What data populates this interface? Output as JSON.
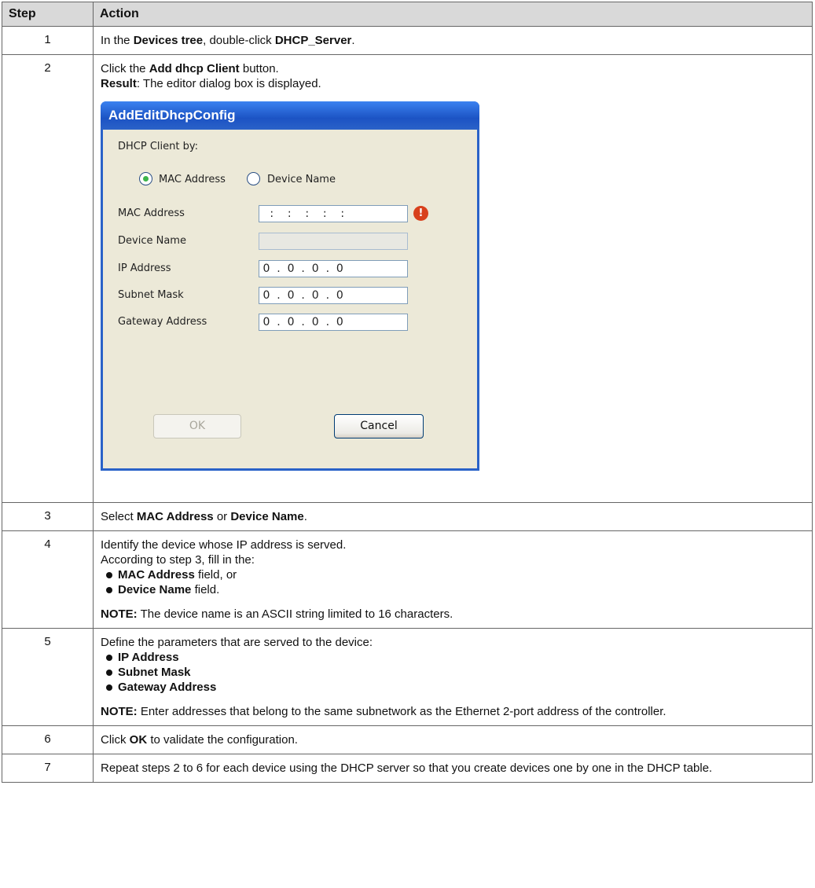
{
  "table": {
    "header": {
      "step": "Step",
      "action": "Action"
    },
    "rows": {
      "r1": {
        "step": "1",
        "t1": "In the ",
        "b1": "Devices tree",
        "t2": ", double-click ",
        "b2": "DHCP_Server",
        "t3": "."
      },
      "r2": {
        "step": "2",
        "t1": "Click the ",
        "b1": "Add dhcp Client",
        "t2": " button.",
        "b2": "Result",
        "t3": ": The editor dialog box is displayed."
      },
      "r3": {
        "step": "3",
        "t1": "Select ",
        "b1": "MAC Address",
        "t2": " or ",
        "b2": "Device Name",
        "t3": "."
      },
      "r4": {
        "step": "4",
        "line1": "Identify the device whose IP address is served.",
        "line2": "According to step 3, fill in the:",
        "bul1_b": "MAC Address",
        "bul1_t": " field, or",
        "bul2_b": "Device Name",
        "bul2_t": " field.",
        "note_b": "NOTE:",
        "note_t": " The device name is an ASCII string limited to 16 characters."
      },
      "r5": {
        "step": "5",
        "line1": "Define the parameters that are served to the device:",
        "bul1": "IP Address",
        "bul2": "Subnet Mask",
        "bul3": "Gateway Address",
        "note_b": "NOTE:",
        "note_t": " Enter addresses that belong to the same subnetwork as the Ethernet 2-port address of the controller."
      },
      "r6": {
        "step": "6",
        "t1": "Click ",
        "b1": "OK",
        "t2": " to validate the configuration."
      },
      "r7": {
        "step": "7",
        "t1": "Repeat steps 2 to 6 for each device using the DHCP server so that you create devices one by one in the DHCP table."
      }
    }
  },
  "dialog": {
    "title": "AddEditDhcpConfig",
    "client_by_label": "DHCP Client by:",
    "radio_mac": "MAC Address",
    "radio_device": "Device Name",
    "selected": "MAC Address",
    "labels": {
      "mac": "MAC Address",
      "device": "Device Name",
      "ip": "IP Address",
      "subnet": "Subnet Mask",
      "gateway": "Gateway Address"
    },
    "values": {
      "mac": "   :    :    :    :    :",
      "device": "",
      "ip": " 0  .  0  .  0  .  0",
      "subnet": " 0  .  0  .  0  .  0",
      "gateway": " 0  .  0  .  0  .  0"
    },
    "warning_icon": "error-icon",
    "ok_label": "OK",
    "cancel_label": "Cancel",
    "colors": {
      "titlebar": "#2a62c8",
      "body": "#ece9d8",
      "radio_dot": "#3cb44a",
      "warning": "#d8401c"
    }
  }
}
